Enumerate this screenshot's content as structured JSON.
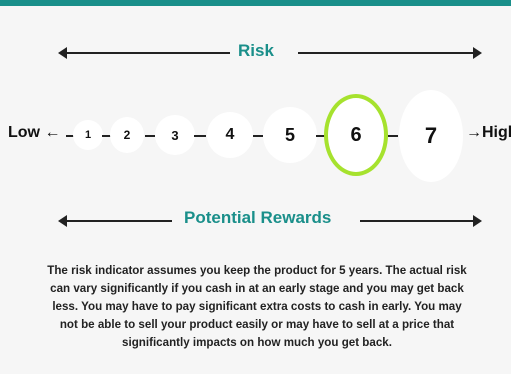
{
  "risk_label": "Risk",
  "rewards_label": "Potential Rewards",
  "low_label": "Low",
  "high_label": "High",
  "scale": [
    {
      "label": "1",
      "selected": false
    },
    {
      "label": "2",
      "selected": false
    },
    {
      "label": "3",
      "selected": false
    },
    {
      "label": "4",
      "selected": false
    },
    {
      "label": "5",
      "selected": false
    },
    {
      "label": "6",
      "selected": true
    },
    {
      "label": "7",
      "selected": false
    }
  ],
  "selected_value": 6,
  "colors": {
    "accent": "#1a8f8a",
    "highlight_ring": "#a6e22e",
    "circle_fill": "#ffffff",
    "background": "#f6f6f6"
  },
  "description_lines": [
    "The risk indicator assumes you keep the product for 5 years. The actual risk",
    "can vary  significantly if you cash in at an early stage and you may get back",
    "less. You may have to  pay  significant extra costs to cash in early. You may",
    "not be able to sell your product  easily or may  have to sell at a price that",
    "significantly impacts on how much you get  back."
  ]
}
